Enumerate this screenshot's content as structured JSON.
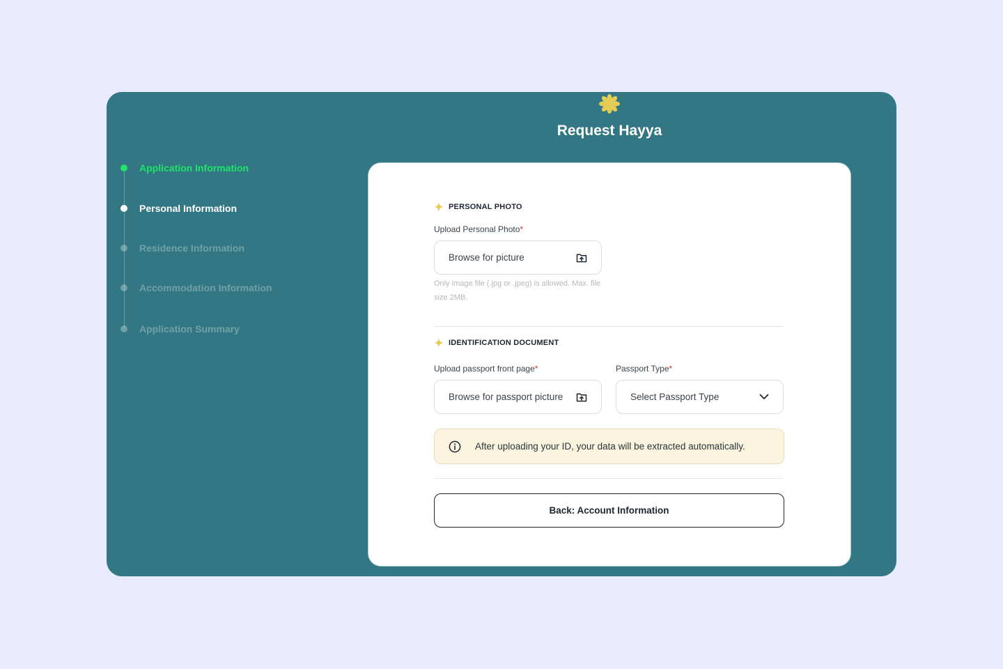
{
  "header": {
    "title": "Request Hayya",
    "logo_icon": "asterisk-flower-icon",
    "logo_color": "#e3cd54"
  },
  "stepper": {
    "items": [
      {
        "label": "Application Information",
        "state": "done"
      },
      {
        "label": "Personal Information",
        "state": "current"
      },
      {
        "label": "Residence Information",
        "state": "upcoming"
      },
      {
        "label": "Accommodation Information",
        "state": "upcoming"
      },
      {
        "label": "Application Summary",
        "state": "upcoming"
      }
    ]
  },
  "personal_photo": {
    "section_title": "PERSONAL PHOTO",
    "upload_label": "Upload Personal Photo",
    "required_mark": "*",
    "browse_text": "Browse for picture",
    "hint": "Only image file (.jpg or .jpeg) is allowed. Max. file size 2MB."
  },
  "identification": {
    "section_title": "IDENTIFICATION DOCUMENT",
    "passport_label": "Upload passport front page",
    "passport_browse_text": "Browse for passport picture",
    "type_label": "Passport Type",
    "type_placeholder": "Select Passport Type",
    "required_mark": "*",
    "notice": "After uploading your ID, your data will be extracted automatically."
  },
  "actions": {
    "back_label": "Back: Account Information"
  },
  "colors": {
    "page_background": "#e9eafd",
    "panel_teal": "#327783",
    "step_done": "#1fe36a",
    "accent_spark": "#e3cd54",
    "required": "#e0283b",
    "notice_background": "#faf4df"
  }
}
